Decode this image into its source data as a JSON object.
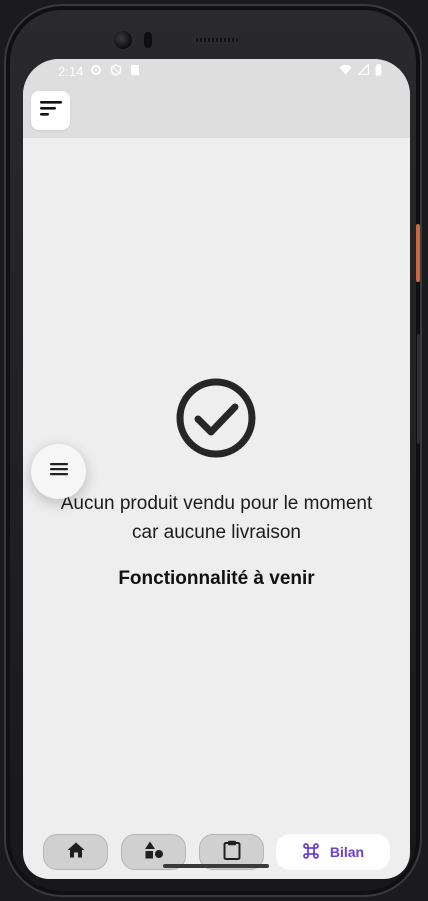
{
  "status": {
    "time": "2:14",
    "left_icons": [
      "gear-icon",
      "shield-icon",
      "clipboard-icon"
    ],
    "right_icons": [
      "wifi-icon",
      "signal-icon",
      "battery-icon"
    ]
  },
  "header": {
    "menu_icon": "sort-lines-icon"
  },
  "content": {
    "icon": "check-circle-icon",
    "message_line1": "Aucun produit vendu pour le moment",
    "message_line2": "car aucune livraison",
    "coming_soon": "Fonctionnalité à venir"
  },
  "fab": {
    "icon": "hamburger-icon"
  },
  "bottom_nav": {
    "items": [
      {
        "icon": "home-icon",
        "label": ""
      },
      {
        "icon": "shapes-icon",
        "label": ""
      },
      {
        "icon": "clipboard-icon",
        "label": ""
      },
      {
        "icon": "command-icon",
        "label": "Bilan"
      }
    ],
    "accent": "#6b3fd6"
  }
}
